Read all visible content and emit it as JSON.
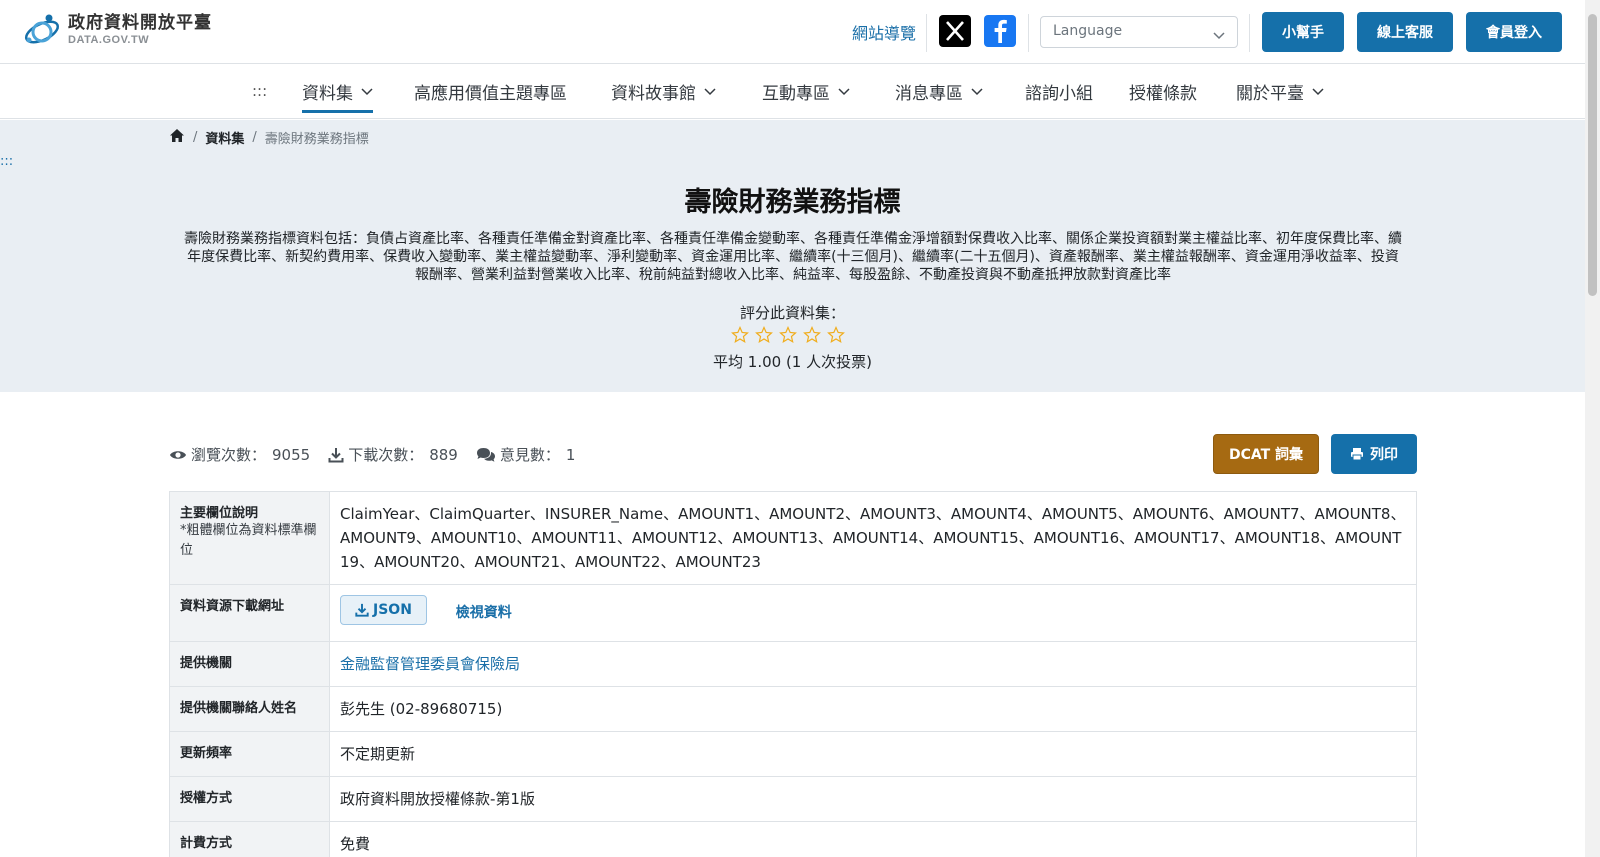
{
  "header": {
    "logo_title": "政府資料開放平臺",
    "logo_sub": "DATA.GOV.TW",
    "sitemap": "網站導覽",
    "language_placeholder": "Language",
    "help": "小幫手",
    "service": "線上客服",
    "login": "會員登入"
  },
  "nav": {
    "accesskey": ":::",
    "items": [
      "資料集",
      "高應用價值主題專區",
      "資料故事館",
      "互動專區",
      "消息專區",
      "諮詢小組",
      "授權條款",
      "關於平臺"
    ]
  },
  "hero": {
    "skip": ":::",
    "breadcrumb": {
      "section": "資料集",
      "current": "壽險財務業務指標"
    },
    "title": "壽險財務業務指標",
    "description": "壽險財務業務指標資料包括：負債占資產比率、各種責任準備金對資產比率、各種責任準備金變動率、各種責任準備金淨增額對保費收入比率、關係企業投資額對業主權益比率、初年度保費比率、續年度保費比率、新契約費用率、保費收入變動率、業主權益變動率、淨利變動率、資金運用比率、繼續率(十三個月)、繼續率(二十五個月)、資產報酬率、業主權益報酬率、資金運用淨收益率、投資報酬率、營業利益對營業收入比率、稅前純益對總收入比率、純益率、每股盈餘、不動產投資與不動產抵押放款對資產比率",
    "rate_label": "評分此資料集：",
    "rating": {
      "value": 0,
      "max": 5
    },
    "average": "平均 1.00 (1 人次投票)"
  },
  "stats": {
    "views_label": "瀏覽次數：",
    "views": "9055",
    "downloads_label": "下載次數：",
    "downloads": "889",
    "comments_label": "意見數：",
    "comments": "1",
    "dcat": "DCAT 詞彙",
    "print": "列印"
  },
  "meta": {
    "fields_key": "主要欄位說明",
    "fields_note": "*粗體欄位為資料標準欄位",
    "fields_value": "ClaimYear、ClaimQuarter、INSURER_Name、AMOUNT1、AMOUNT2、AMOUNT3、AMOUNT4、AMOUNT5、AMOUNT6、AMOUNT7、AMOUNT8、AMOUNT9、AMOUNT10、AMOUNT11、AMOUNT12、AMOUNT13、AMOUNT14、AMOUNT15、AMOUNT16、AMOUNT17、AMOUNT18、AMOUNT19、AMOUNT20、AMOUNT21、AMOUNT22、AMOUNT23",
    "download_key": "資料資源下載網址",
    "json_label": "JSON",
    "view_label": "檢視資料",
    "org_key": "提供機關",
    "org_value": "金融監督管理委員會保險局",
    "contact_key": "提供機關聯絡人姓名",
    "contact_value": "彭先生 (02-89680715)",
    "freq_key": "更新頻率",
    "freq_value": "不定期更新",
    "license_key": "授權方式",
    "license_value": "政府資料開放授權條款-第1版",
    "fee_key": "計費方式",
    "fee_value": "免費"
  },
  "colors": {
    "primary": "#1570aa",
    "dcat": "#a66a12",
    "hero_bg": "#e9eef3",
    "star": "#f0ad1e"
  }
}
